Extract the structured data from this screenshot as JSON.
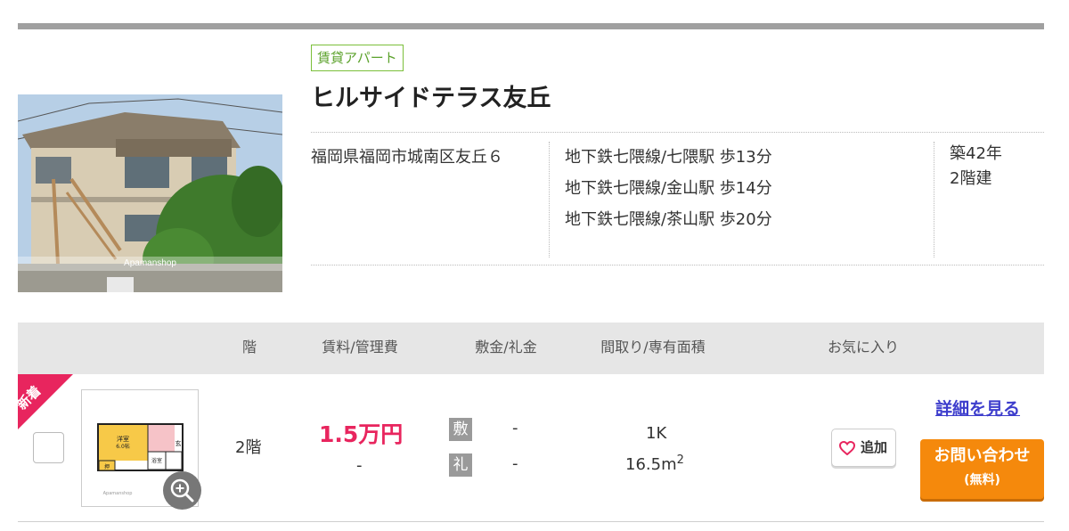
{
  "property": {
    "type_tag": "賃貸アパート",
    "name": "ヒルサイドテラス友丘",
    "address": "福岡県福岡市城南区友丘６",
    "stations": [
      "地下鉄七隈線/七隈駅 歩13分",
      "地下鉄七隈線/金山駅 歩14分",
      "地下鉄七隈線/茶山駅 歩20分"
    ],
    "age": "築42年",
    "floors": "2階建",
    "photo_watermark": "Apamanshop"
  },
  "table": {
    "headers": [
      "階",
      "賃料/管理費",
      "敷金/礼金",
      "間取り/専有面積",
      "お気に入り"
    ]
  },
  "unit": {
    "new_badge": "新着",
    "floor": "2階",
    "rent": "1.5万円",
    "management_fee": "-",
    "deposit_label": "敷",
    "deposit": "-",
    "key_money_label": "礼",
    "key_money": "-",
    "layout": "1K",
    "area_value": "16.5m",
    "area_unit": "2",
    "floorplan": {
      "room_label": "洋室",
      "room_size": "6.0帖",
      "entrance": "玄",
      "bath": "浴室",
      "closet": "押",
      "watermark": "Apamanshop"
    }
  },
  "actions": {
    "favorite_label": "追加",
    "detail_link": "詳細を見る",
    "contact_line1": "お問い合わせ",
    "contact_line2": "(無料)"
  },
  "colors": {
    "accent_rent": "#e8255e",
    "new_badge": "#e8255e",
    "contact_button": "#f5890c",
    "tag_border": "#7bbf3a",
    "detail_link": "#3d3dcc"
  },
  "icons": [
    "magnifier-plus-icon",
    "heart-outline-icon"
  ]
}
